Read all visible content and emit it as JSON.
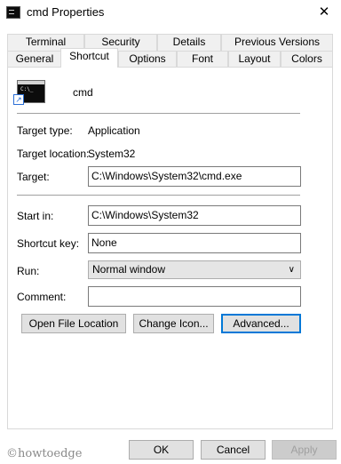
{
  "window": {
    "title": "cmd Properties",
    "close_glyph": "✕"
  },
  "tabs": {
    "row1": [
      "Terminal",
      "Security",
      "Details",
      "Previous Versions"
    ],
    "row2": [
      "General",
      "Shortcut",
      "Options",
      "Font",
      "Layout",
      "Colors"
    ],
    "active": "Shortcut"
  },
  "shortcut": {
    "name": "cmd",
    "icon": "command-prompt-icon",
    "target_type_label": "Target type:",
    "target_type_value": "Application",
    "target_location_label": "Target location:",
    "target_location_value": "System32",
    "target_label": "Target:",
    "target_value": "C:\\Windows\\System32\\cmd.exe",
    "start_in_label": "Start in:",
    "start_in_value": "C:\\Windows\\System32",
    "shortcut_key_label": "Shortcut key:",
    "shortcut_key_value": "None",
    "run_label": "Run:",
    "run_value": "Normal window",
    "comment_label": "Comment:",
    "comment_value": ""
  },
  "buttons": {
    "open_file_location": "Open File Location",
    "change_icon": "Change Icon...",
    "advanced": "Advanced...",
    "ok": "OK",
    "cancel": "Cancel",
    "apply": "Apply"
  },
  "watermark": "©howtoedge",
  "colors": {
    "focus": "#0078d7",
    "button": "#e1e1e1"
  }
}
